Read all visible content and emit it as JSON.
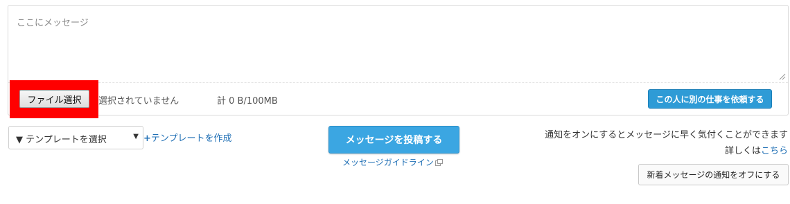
{
  "composer": {
    "message_placeholder": "ここにメッセージ",
    "message_value": "",
    "file_button_label": "ファイル選択",
    "file_status": "選択されていません",
    "file_total": "計 0 B/100MB",
    "request_button_label": "この人に別の仕事を依頼する"
  },
  "template": {
    "select_label": "▼ テンプレートを選択",
    "create_link_plus": "+",
    "create_link_label": "テンプレートを作成"
  },
  "post": {
    "button_label": "メッセージを投稿する",
    "guideline_label": "メッセージガイドライン"
  },
  "notification": {
    "description": "通知をオンにするとメッセージに早く気付くことができます",
    "details_prefix": "詳しくは",
    "details_link": "こちら",
    "toggle_button_label": "新着メッセージの通知をオフにする"
  },
  "colors": {
    "primary_button": "#3ba6e2",
    "link": "#1f6fb5",
    "highlight_box": "#ff0000"
  },
  "icons": {
    "select_arrow": "caret-down-icon",
    "guideline_external": "external-link-icon",
    "textarea_resize": "resize-grip-icon"
  }
}
